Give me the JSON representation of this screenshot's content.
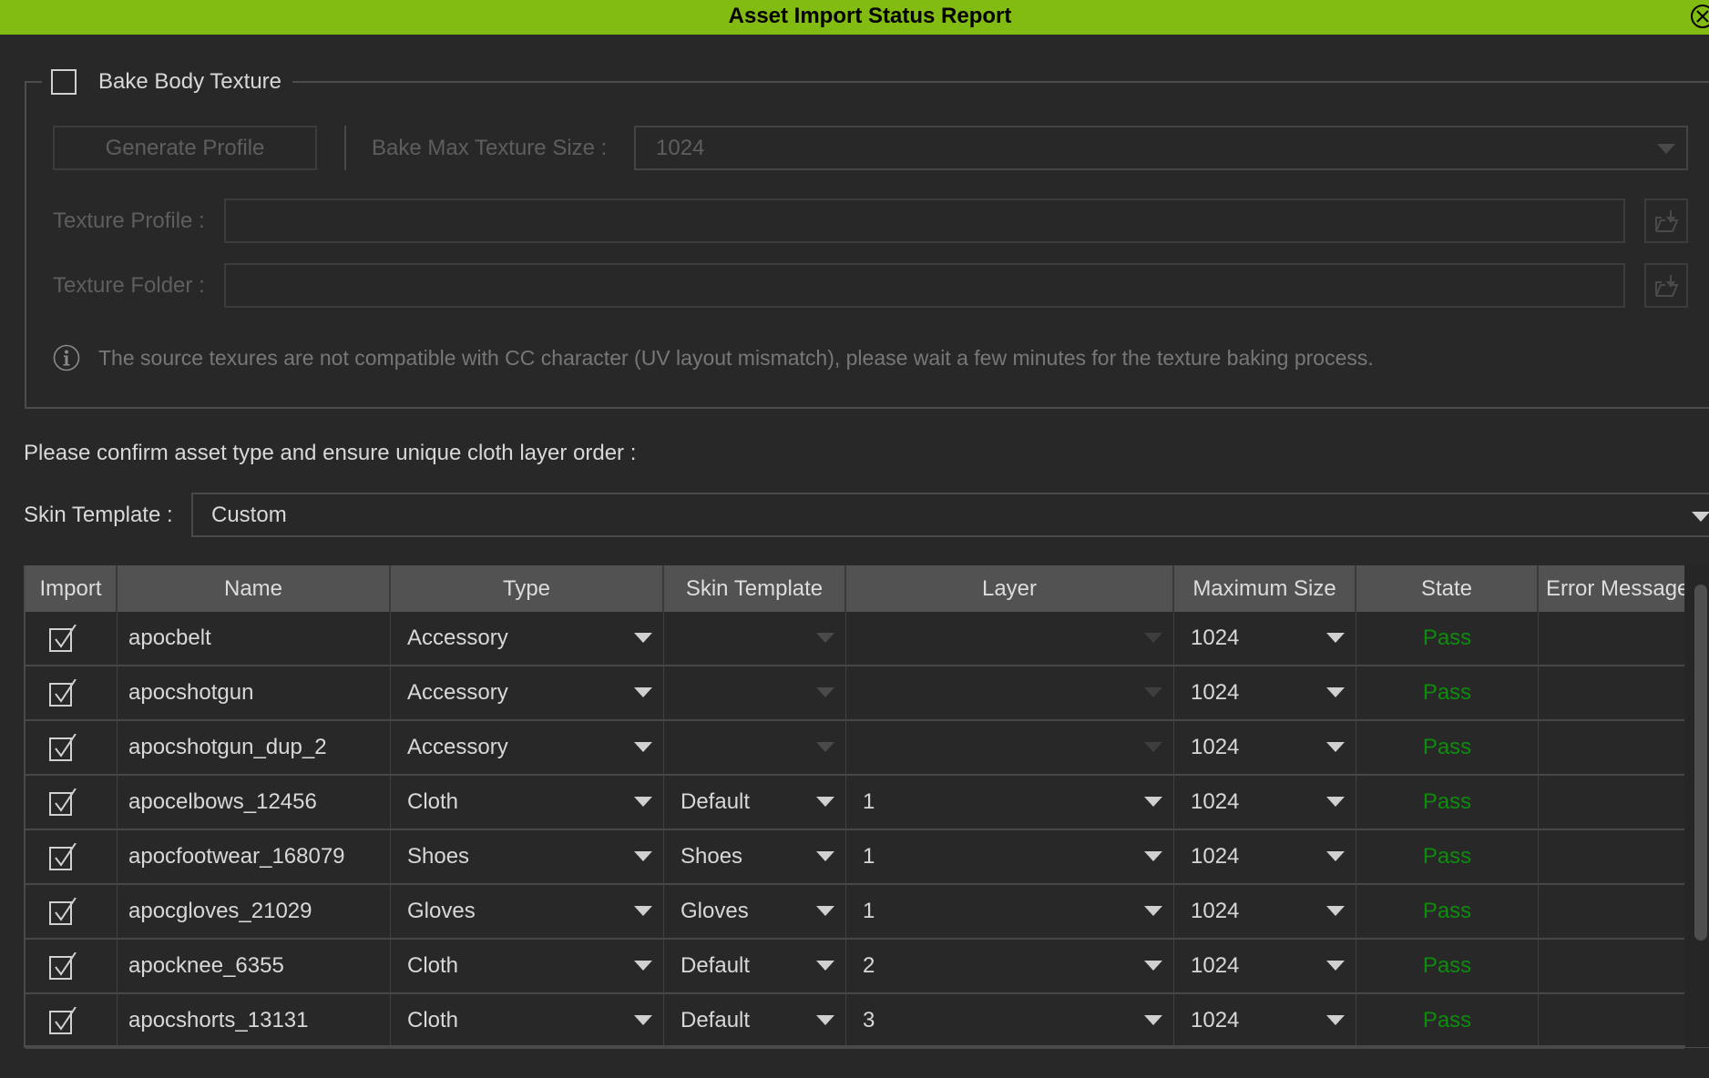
{
  "window": {
    "title": "Asset Import Status Report",
    "close_icon": "close-circle-icon"
  },
  "bake": {
    "checkbox_label": "Bake Body Texture",
    "checked": false,
    "generate_profile_label": "Generate Profile",
    "bake_max_size_label": "Bake Max Texture Size :",
    "bake_max_size_value": "1024",
    "texture_profile_label": "Texture Profile :",
    "texture_profile_value": "",
    "texture_folder_label": "Texture Folder :",
    "texture_folder_value": "",
    "browse_icon": "folder-import-icon",
    "info_icon": "info-icon",
    "info_text": "The source texures are not compatible with CC character (UV layout mismatch), please wait a few minutes for the texture baking process."
  },
  "instructions": "Please confirm asset type and ensure unique cloth layer order :",
  "skin_template": {
    "label": "Skin Template :",
    "value": "Custom"
  },
  "table": {
    "columns": [
      "Import",
      "Name",
      "Type",
      "Skin Template",
      "Layer",
      "Maximum Size",
      "State",
      "Error Message"
    ],
    "rows": [
      {
        "import": true,
        "name": "apocbelt",
        "type": "Accessory",
        "skin_template": "",
        "layer": "",
        "max_size": "1024",
        "state": "Pass",
        "error": ""
      },
      {
        "import": true,
        "name": "apocshotgun",
        "type": "Accessory",
        "skin_template": "",
        "layer": "",
        "max_size": "1024",
        "state": "Pass",
        "error": ""
      },
      {
        "import": true,
        "name": "apocshotgun_dup_2",
        "type": "Accessory",
        "skin_template": "",
        "layer": "",
        "max_size": "1024",
        "state": "Pass",
        "error": ""
      },
      {
        "import": true,
        "name": "apocelbows_12456",
        "type": "Cloth",
        "skin_template": "Default",
        "layer": "1",
        "max_size": "1024",
        "state": "Pass",
        "error": ""
      },
      {
        "import": true,
        "name": "apocfootwear_168079",
        "type": "Shoes",
        "skin_template": "Shoes",
        "layer": "1",
        "max_size": "1024",
        "state": "Pass",
        "error": ""
      },
      {
        "import": true,
        "name": "apocgloves_21029",
        "type": "Gloves",
        "skin_template": "Gloves",
        "layer": "1",
        "max_size": "1024",
        "state": "Pass",
        "error": ""
      },
      {
        "import": true,
        "name": "apocknee_6355",
        "type": "Cloth",
        "skin_template": "Default",
        "layer": "2",
        "max_size": "1024",
        "state": "Pass",
        "error": ""
      },
      {
        "import": true,
        "name": "apocshorts_13131",
        "type": "Cloth",
        "skin_template": "Default",
        "layer": "3",
        "max_size": "1024",
        "state": "Pass",
        "error": ""
      }
    ]
  },
  "colors": {
    "title_bar": "#82bb12",
    "background": "#282828",
    "header": "#525252",
    "pass": "#0d8c0d"
  }
}
